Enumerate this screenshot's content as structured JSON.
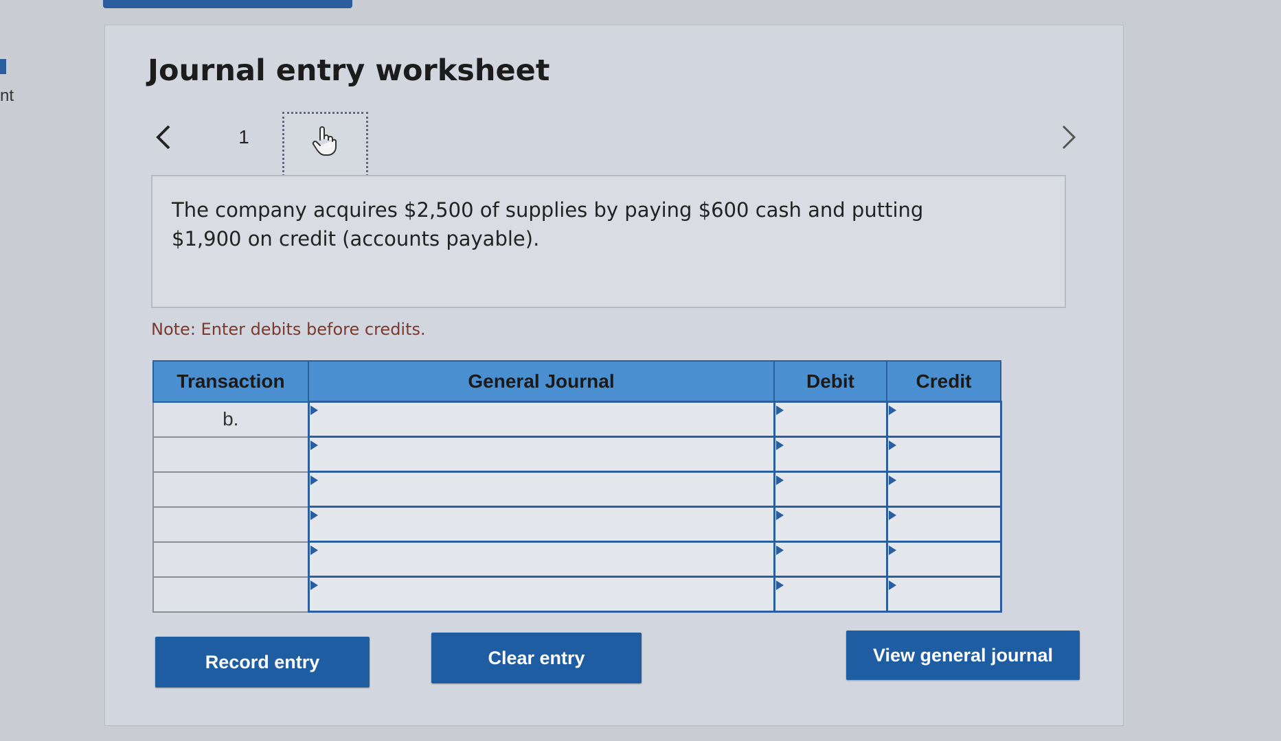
{
  "left_edge": {
    "text": "nt"
  },
  "title": "Journal entry worksheet",
  "pagination": {
    "current_page": "1"
  },
  "question": "The company acquires $2,500 of supplies by paying $600 cash and putting $1,900 on credit (accounts payable).",
  "note": "Note: Enter debits before credits.",
  "table": {
    "headers": {
      "transaction": "Transaction",
      "general_journal": "General Journal",
      "debit": "Debit",
      "credit": "Credit"
    },
    "rows": [
      {
        "transaction": "b.",
        "account": "",
        "debit": "",
        "credit": ""
      },
      {
        "transaction": "",
        "account": "",
        "debit": "",
        "credit": ""
      },
      {
        "transaction": "",
        "account": "",
        "debit": "",
        "credit": ""
      },
      {
        "transaction": "",
        "account": "",
        "debit": "",
        "credit": ""
      },
      {
        "transaction": "",
        "account": "",
        "debit": "",
        "credit": ""
      },
      {
        "transaction": "",
        "account": "",
        "debit": "",
        "credit": ""
      }
    ]
  },
  "buttons": {
    "record": "Record entry",
    "clear": "Clear entry",
    "view": "View general journal"
  },
  "icons": {
    "prev": "chevron-left-icon",
    "next": "chevron-right-icon",
    "pointer": "hand-pointer-icon"
  },
  "colors": {
    "accent": "#1f5da3",
    "header": "#4a8fd0",
    "note": "#7a3a2e"
  }
}
